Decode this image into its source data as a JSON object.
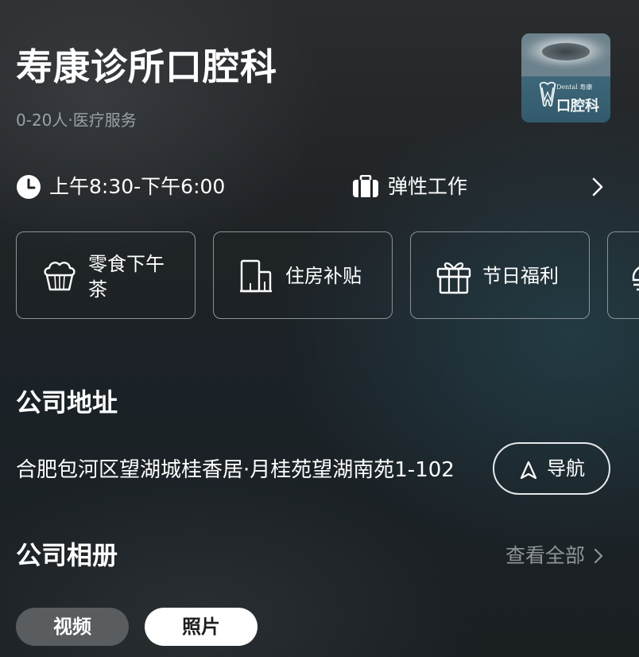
{
  "company": {
    "name": "寿康诊所口腔科",
    "meta": "0-20人·医疗服务",
    "logo": {
      "small_text": "Dental 寿康",
      "big_text": "口腔科"
    }
  },
  "info_row": {
    "hours": "上午8:30-下午6:00",
    "work_type": "弹性工作"
  },
  "benefits": [
    {
      "label": "零食下午茶",
      "icon": "cupcake-icon"
    },
    {
      "label": "住房补贴",
      "icon": "building-icon"
    },
    {
      "label": "节日福利",
      "icon": "gift-icon"
    }
  ],
  "address_section": {
    "title": "公司地址",
    "address": "合肥包河区望湖城桂香居·月桂苑望湖南苑1-102",
    "nav_label": "导航"
  },
  "album_section": {
    "title": "公司相册",
    "view_all": "查看全部",
    "tabs": [
      {
        "label": "视频",
        "selected": false
      },
      {
        "label": "照片",
        "selected": true
      }
    ]
  },
  "colors": {
    "text_primary": "#ffffff",
    "text_secondary": "#9aa0a4",
    "card_border": "#8c9296",
    "tab_selected_bg": "#ffffff",
    "tab_unselected_bg": "#5a5d60"
  }
}
